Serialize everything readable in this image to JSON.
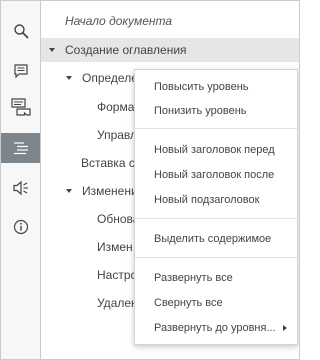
{
  "sidebar": {
    "buttons": [
      {
        "icon": "search-icon"
      },
      {
        "icon": "comments-icon"
      },
      {
        "icon": "chat-icon"
      },
      {
        "icon": "navigation-icon",
        "active": true
      },
      {
        "icon": "speaker-icon"
      },
      {
        "icon": "info-icon"
      }
    ],
    "active_color": "#7d858c"
  },
  "navigation": {
    "items": [
      {
        "label": "Начало документа"
      },
      {
        "label": "Создание оглавления"
      },
      {
        "label": "Определе"
      },
      {
        "label": "Форма"
      },
      {
        "label": "Управл"
      },
      {
        "label": "Вставка с"
      },
      {
        "label": "Изменени"
      },
      {
        "label": "Обнова"
      },
      {
        "label": "Измен"
      },
      {
        "label": "Настрс"
      },
      {
        "label": "Удален"
      }
    ]
  },
  "context_menu": {
    "groups": [
      [
        {
          "label": "Повысить уровень"
        },
        {
          "label": "Понизить уровень"
        }
      ],
      [
        {
          "label": "Новый заголовок перед"
        },
        {
          "label": "Новый заголовок после"
        },
        {
          "label": "Новый подзаголовок"
        }
      ],
      [
        {
          "label": "Выделить содержимое"
        }
      ],
      [
        {
          "label": "Развернуть все"
        },
        {
          "label": "Свернуть все"
        },
        {
          "label": "Развернуть до уровня..."
        }
      ]
    ]
  }
}
